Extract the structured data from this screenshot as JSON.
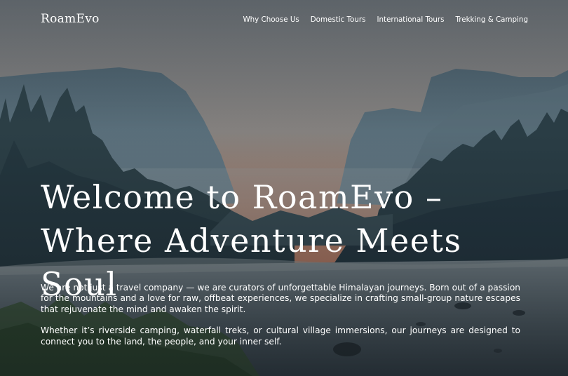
{
  "brand": {
    "logo": "RoamEvo"
  },
  "nav": {
    "items": [
      {
        "label": "Why Choose Us"
      },
      {
        "label": "Domestic Tours"
      },
      {
        "label": "International Tours"
      },
      {
        "label": "Trekking & Camping"
      }
    ]
  },
  "hero": {
    "title_line1": "Welcome to RoamEvo –",
    "title_line2": "Where Adventure Meets Soul",
    "paragraph1": "We are not just a travel company — we are curators of unforgettable Himalayan journeys. Born out of a passion for the mountains and a love for raw, offbeat experiences, we specialize in crafting small-group nature escapes that rejuvenate the mind and awaken the spirit.",
    "paragraph2": "Whether it’s riverside camping, waterfall treks, or cultural village immersions, our journeys are designed to connect you to the land, the people, and your inner self."
  },
  "colors": {
    "text": "#ffffff",
    "sky_glow": "#c9856a",
    "forest": "#2c4048"
  }
}
